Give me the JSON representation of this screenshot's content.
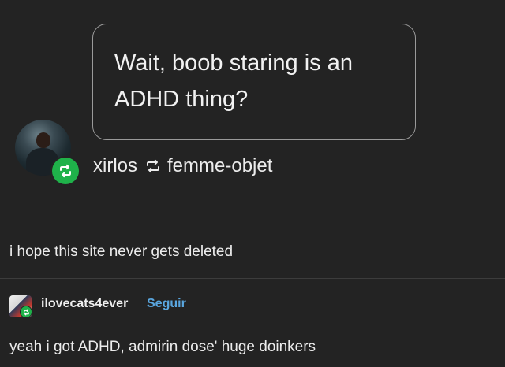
{
  "question": {
    "line1": "Wait, boob staring is an",
    "line2": "ADHD thing?"
  },
  "reblog": {
    "from_user": "xirlos",
    "via_user": "femme-objet",
    "badge_icon": "reblog-icon",
    "badge_color": "#1fb24a"
  },
  "post": {
    "body": "i hope this site never gets deleted"
  },
  "reply": {
    "username": "ilovecats4ever",
    "follow_label": "Seguir",
    "follow_color": "#5aa7e0",
    "text": "yeah i got ADHD, admirin dose' huge doinkers"
  },
  "theme": {
    "background": "#232323",
    "text": "#ececec"
  }
}
